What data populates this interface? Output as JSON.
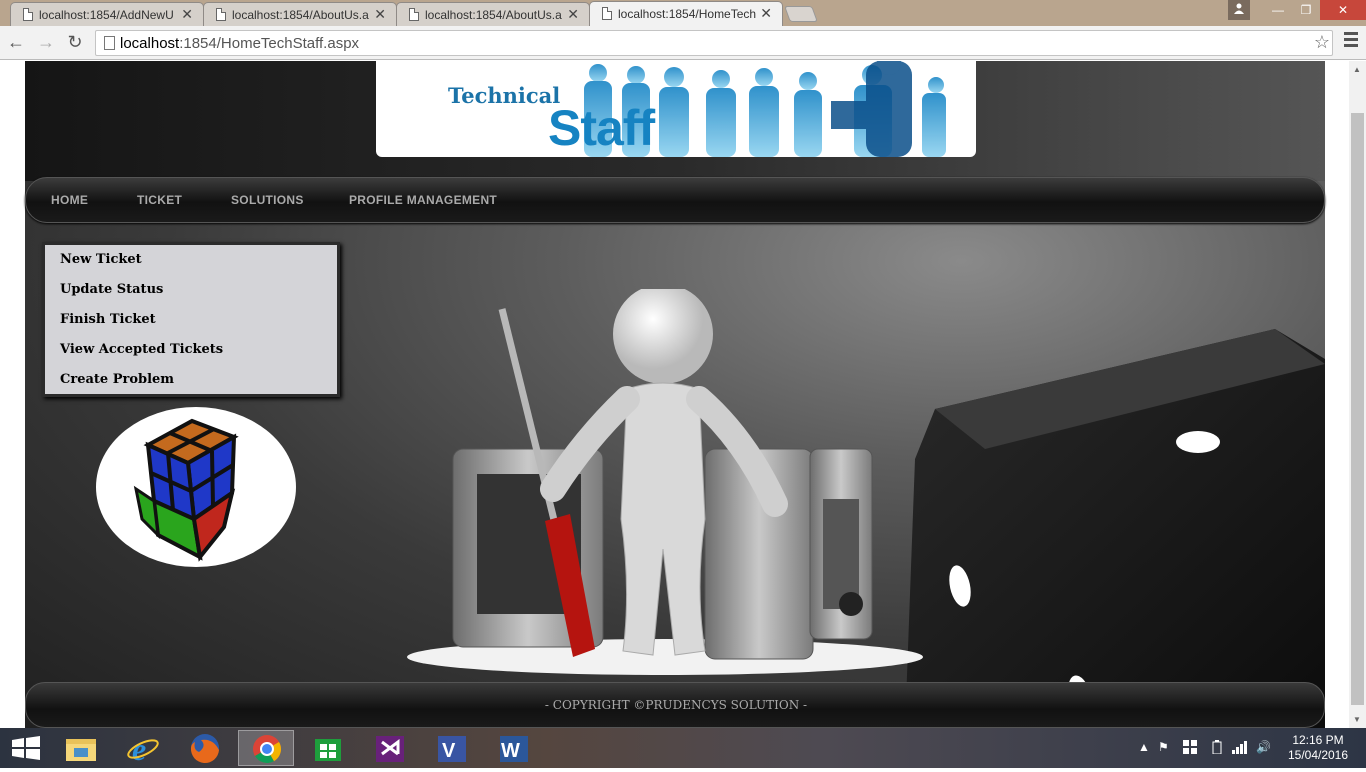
{
  "browser": {
    "tabs": [
      {
        "title": "localhost:1854/AddNewU",
        "close": "✕"
      },
      {
        "title": "localhost:1854/AboutUs.a",
        "close": "✕"
      },
      {
        "title": "localhost:1854/AboutUs.a",
        "close": "✕"
      },
      {
        "title": "localhost:1854/HomeTech",
        "close": "✕"
      }
    ],
    "window_controls": {
      "minimize": "—",
      "maximize": "❐",
      "close": "✕"
    },
    "address": {
      "host": "localhost",
      "rest": ":1854/HomeTechStaff.aspx"
    },
    "nav": {
      "back": "←",
      "forward": "→",
      "reload": "↻",
      "bookmark": "☆"
    }
  },
  "site": {
    "banner": {
      "line1": "Technical",
      "line2": "Staff"
    },
    "nav": [
      "HOME",
      "TICKET",
      "SOLUTIONS",
      "PROFILE MANAGEMENT"
    ],
    "submenu": [
      "New Ticket",
      "Update Status",
      "Finish Ticket",
      "View Accepted Tickets",
      "Create Problem"
    ],
    "footer": "- COPYRIGHT ©PRUDENCYS SOLUTION -"
  },
  "taskbar": {
    "apps": [
      "windows-start-icon",
      "file-explorer-icon",
      "internet-explorer-icon",
      "firefox-icon",
      "chrome-icon",
      "store-icon",
      "visual-studio-icon",
      "visio-icon",
      "word-icon"
    ],
    "clock": {
      "time": "12:16 PM",
      "date": "15/04/2016"
    }
  },
  "colors": {
    "accent_blue": "#1683c2",
    "close_red": "#c7473b"
  }
}
